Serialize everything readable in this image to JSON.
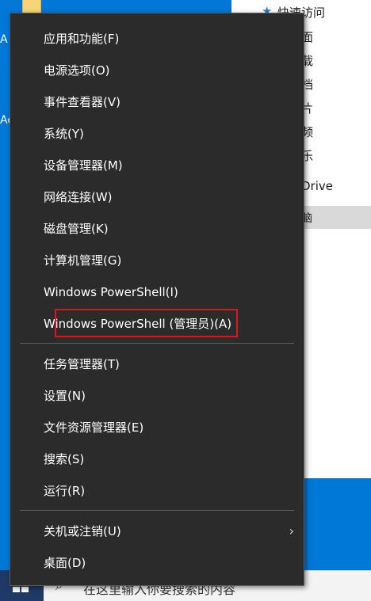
{
  "menu": {
    "items": [
      {
        "label": "应用和功能(F)"
      },
      {
        "label": "电源选项(O)"
      },
      {
        "label": "事件查看器(V)"
      },
      {
        "label": "系统(Y)"
      },
      {
        "label": "设备管理器(M)"
      },
      {
        "label": "网络连接(W)"
      },
      {
        "label": "磁盘管理(K)"
      },
      {
        "label": "计算机管理(G)"
      },
      {
        "label": "Windows PowerShell(I)"
      },
      {
        "label": "Windows PowerShell (管理员)(A)"
      },
      {
        "label": "任务管理器(T)"
      },
      {
        "label": "设置(N)"
      },
      {
        "label": "文件资源管理器(E)"
      },
      {
        "label": "搜索(S)"
      },
      {
        "label": "运行(R)"
      },
      {
        "label": "关机或注销(U)",
        "submenu_icon": "chevron-right-icon"
      },
      {
        "label": "桌面(D)"
      }
    ],
    "highlighted_item": "Windows PowerShell (管理员)(A)",
    "highlight_color": "#e0141e"
  },
  "explorer": {
    "quick_access_label": "快速访问",
    "partial_items": [
      "面",
      "载",
      "档",
      "片",
      "频",
      "乐",
      "Drive",
      "脑"
    ]
  },
  "desktop": {
    "partial_labels": [
      "A",
      "Ac"
    ]
  },
  "taskbar": {
    "search_placeholder": "在这里输入你要搜索的内容"
  },
  "colors": {
    "desktop": "#0078d7",
    "menu_bg": "#2b2b2b",
    "menu_text": "#ffffff"
  }
}
